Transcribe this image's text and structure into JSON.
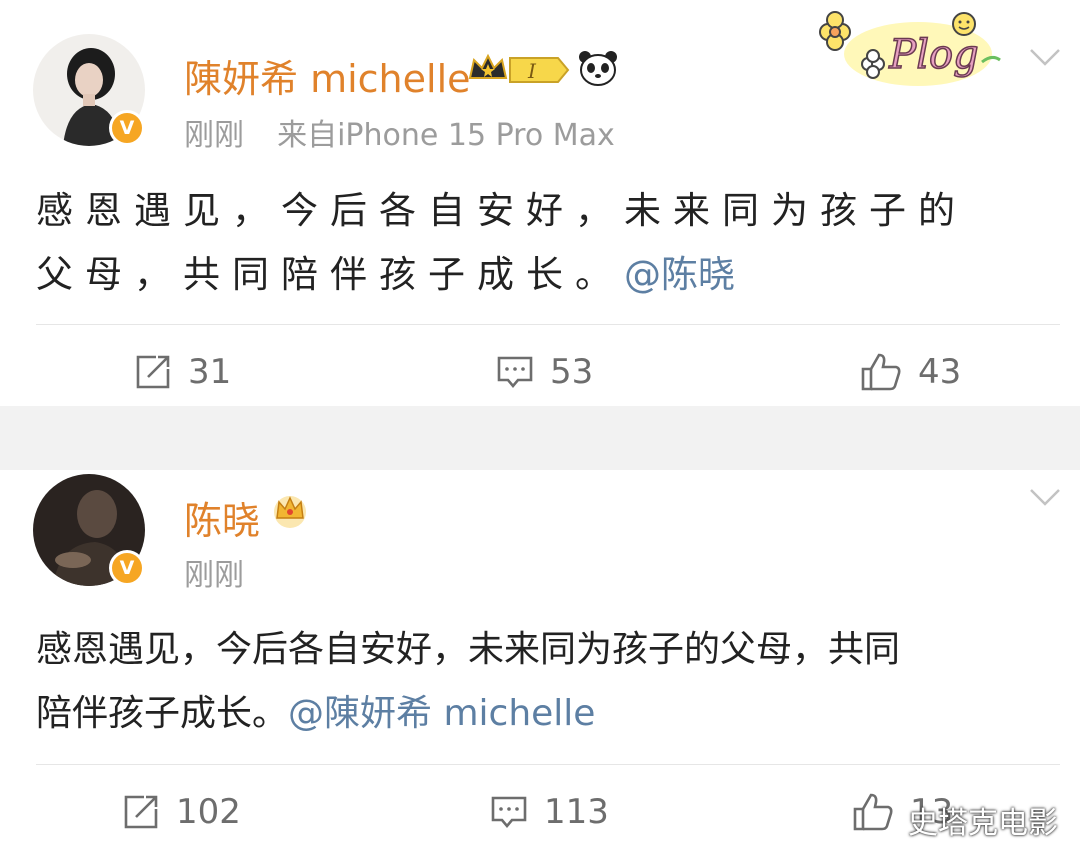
{
  "posts": [
    {
      "username": "陳妍希 michelle",
      "level_badge": "I",
      "time": "刚刚",
      "source": "来自iPhone 15 Pro Max",
      "text_line1": "感恩遇见，今后各自安好，未来同为孩子的",
      "text_line2": "父母，共同陪伴孩子成长。",
      "mention": "@陈晓",
      "counts": {
        "repost": "31",
        "comment": "53",
        "like": "43"
      },
      "decoration_text": "Plog"
    },
    {
      "username": "陈晓",
      "time": "刚刚",
      "text_line1": "感恩遇见，今后各自安好，未来同为孩子的父母，共同",
      "text_line2": "陪伴孩子成长。",
      "mention": "@陳妍希 michelle",
      "counts": {
        "repost": "102",
        "comment": "113",
        "like": "13"
      }
    }
  ],
  "watermark": "史塔克电影",
  "colors": {
    "username": "#e0822b",
    "mention": "#5d7fa3",
    "meta": "#9c9c9c",
    "verified": "#f6a623",
    "background": "#f2f2f2"
  },
  "icons": [
    "repost-icon",
    "comment-icon",
    "like-icon",
    "chevron-down-icon",
    "verified-icon",
    "crown-icon",
    "panda-icon"
  ]
}
